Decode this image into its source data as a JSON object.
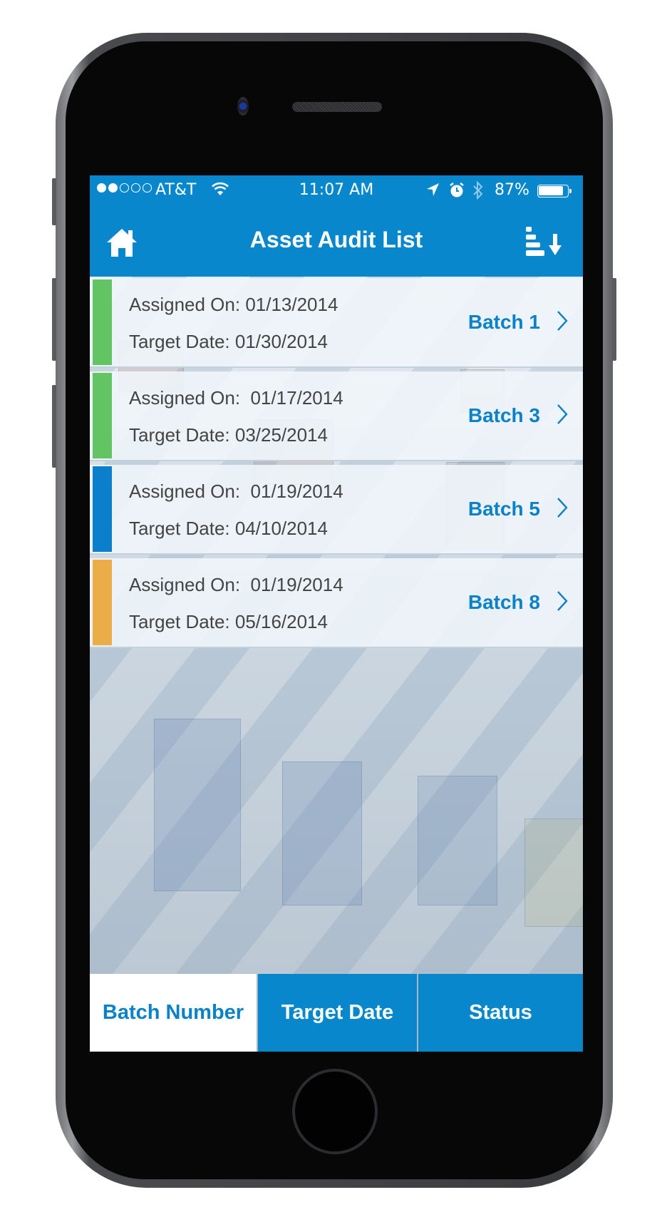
{
  "status_bar": {
    "signal_filled": 2,
    "signal_total": 5,
    "carrier": "AT&T",
    "wifi_icon": "wifi-icon",
    "time": "11:07 AM",
    "location_icon": "location-arrow-icon",
    "alarm_icon": "alarm-clock-icon",
    "bluetooth_icon": "bluetooth-icon",
    "battery_percent_label": "87%",
    "battery_level": 0.87
  },
  "header": {
    "title": "Asset Audit List",
    "left_icon": "home-icon",
    "right_icon": "sort-descending-icon"
  },
  "audits": [
    {
      "assigned_label": "Assigned On: 01/13/2014",
      "target_label": "Target Date: 01/30/2014",
      "batch": "Batch 1",
      "status_color": "#62c462"
    },
    {
      "assigned_label": "Assigned On:  01/17/2014",
      "target_label": "Target Date: 03/25/2014",
      "batch": "Batch 3",
      "status_color": "#62c462"
    },
    {
      "assigned_label": "Assigned On:  01/19/2014",
      "target_label": "Target Date: 04/10/2014",
      "batch": "Batch 5",
      "status_color": "#0b7fcc"
    },
    {
      "assigned_label": "Assigned On:  01/19/2014",
      "target_label": "Target Date: 05/16/2014",
      "batch": "Batch 8",
      "status_color": "#ecac48"
    }
  ],
  "sort_tabs": [
    {
      "label": "Batch Number",
      "active": true
    },
    {
      "label": "Target Date",
      "active": false
    },
    {
      "label": "Status",
      "active": false
    }
  ],
  "colors": {
    "primary": "#0987cd",
    "accent_text": "#0b82c8",
    "status_green": "#62c462",
    "status_blue": "#0b7fcc",
    "status_orange": "#ecac48"
  }
}
